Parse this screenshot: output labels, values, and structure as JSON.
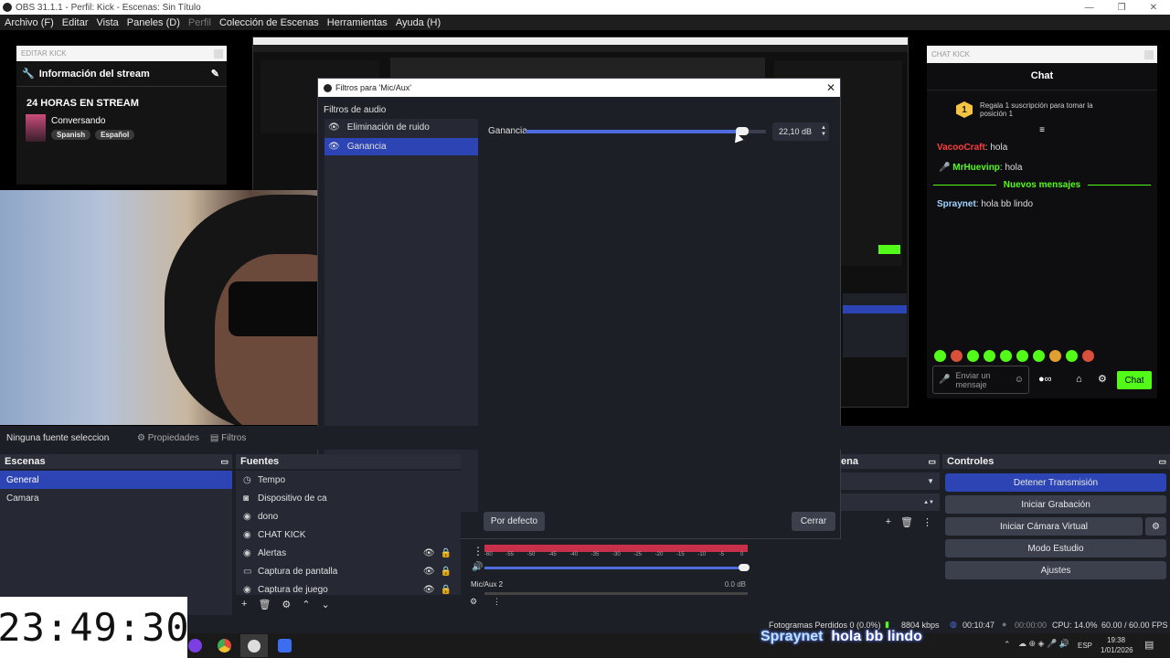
{
  "window": {
    "title": "OBS 31.1.1 - Perfil: Kick - Escenas: Sin Título",
    "minimize": "—",
    "restore": "❐",
    "close": "✕"
  },
  "menu": [
    "Archivo (F)",
    "Editar",
    "Vista",
    "Paneles (D)",
    "Perfil",
    "Colección de Escenas",
    "Herramientas",
    "Ayuda (H)"
  ],
  "kick_panel": {
    "dock_title": "EDITAR KICK",
    "header": "Información del stream",
    "stream_title": "24 HORAS EN STREAM",
    "category": "Conversando",
    "tags": [
      "Spanish",
      "Español"
    ]
  },
  "chat_panel": {
    "dock_title": "CHAT KICK",
    "header": "Chat",
    "pinned": "Regala 1 suscripción para tomar la posición 1",
    "pinned_rank": "1",
    "messages": [
      {
        "user": "VacooCraft",
        "text": "hola",
        "color": "#ff3d3d"
      },
      {
        "user": "MrHuevinp",
        "text": "hola",
        "color": "#53fc18"
      }
    ],
    "new_messages": "Nuevos mensajes",
    "new_msg": {
      "user": "Spraynet",
      "text": "hola bb lindo",
      "color": "#9fd4ff"
    },
    "input_placeholder": "Enviar un mensaje",
    "send": "Chat"
  },
  "dialog": {
    "title": "Filtros para 'Mic/Aux'",
    "section": "Filtros de audio",
    "filters": [
      {
        "name": "Eliminación de ruido",
        "selected": false
      },
      {
        "name": "Ganancia",
        "selected": true
      }
    ],
    "gain_label": "Ganancia",
    "gain_value": "22,10 dB",
    "gain_fraction": 0.9,
    "default_btn": "Por defecto",
    "close_btn": "Cerrar"
  },
  "source_bar": {
    "none": "Ninguna fuente seleccionad",
    "properties": "Propiedades",
    "filters": "Filtros"
  },
  "scenes": {
    "header": "Escenas",
    "items": [
      "General",
      "Camara"
    ],
    "selected": 0
  },
  "sources": {
    "header": "Fuentes",
    "items": [
      "Tempo",
      "Dispositivo de ca",
      "dono",
      "CHAT KICK",
      "Alertas",
      "Captura de pantalla",
      "Captura de juego"
    ]
  },
  "transitions_header": "ena",
  "mixer": {
    "ticks": [
      "-60",
      "-55",
      "-50",
      "-45",
      "-40",
      "-35",
      "-30",
      "-25",
      "-20",
      "-15",
      "-10",
      "-5",
      "0"
    ],
    "track": "Mic/Aux 2",
    "db": "0.0 dB"
  },
  "controls": {
    "header": "Controles",
    "buttons": [
      "Detener Transmisión",
      "Iniciar Grabación",
      "Iniciar Cámara Virtual",
      "Modo Estudio",
      "Ajustes"
    ]
  },
  "status": {
    "dropped": "Fotogramas Perdidos 0 (0.0%)",
    "kbps": "8804 kbps",
    "stream_time": "00:10:47",
    "rec_time": "00:00:00",
    "cpu": "CPU: 14.0%",
    "fps": "60.00 / 60.00 FPS"
  },
  "overlay_chat": {
    "user": "Spraynet",
    "text": "hola bb lindo"
  },
  "clock": "23:49:30",
  "taskbar": {
    "lang": "ESP",
    "time": "19:38",
    "date": "1/01/2026"
  },
  "colors": {
    "accent": "#2c44b4",
    "kick_green": "#53fc18",
    "meter_red": "#c8304a"
  }
}
